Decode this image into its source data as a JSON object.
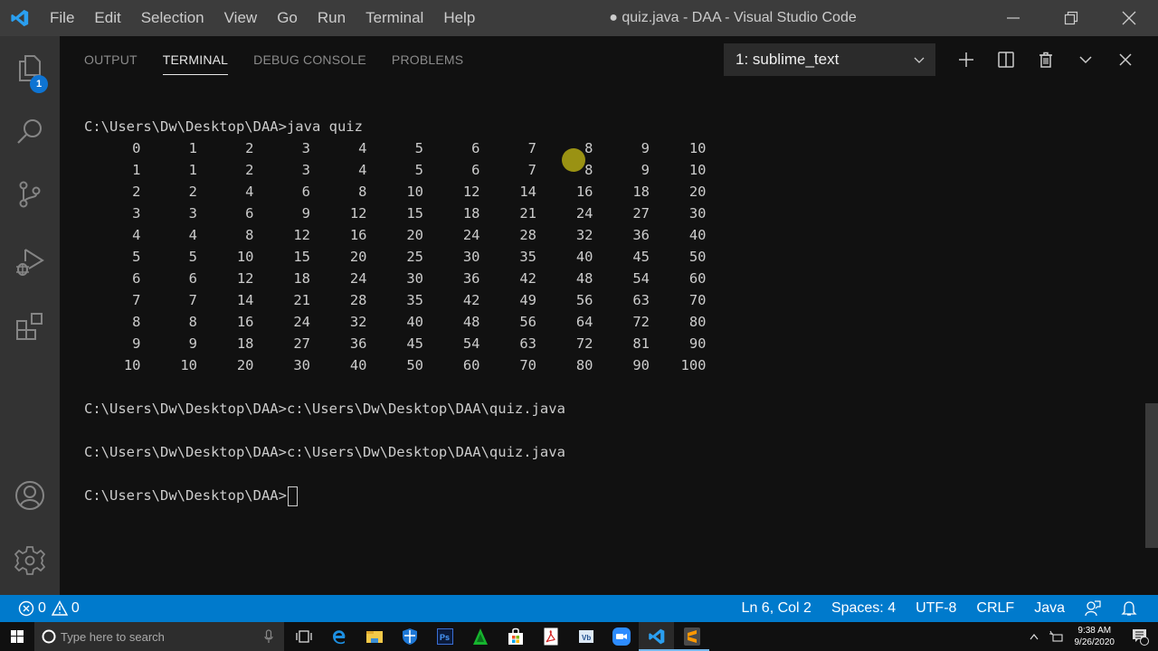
{
  "titlebar": {
    "menu": [
      "File",
      "Edit",
      "Selection",
      "View",
      "Go",
      "Run",
      "Terminal",
      "Help"
    ],
    "window_title": "● quiz.java - DAA - Visual Studio Code"
  },
  "activity_bar": {
    "items": [
      {
        "name": "explorer",
        "badge": "1"
      },
      {
        "name": "search"
      },
      {
        "name": "source-control"
      },
      {
        "name": "run-debug"
      },
      {
        "name": "extensions"
      }
    ],
    "bottom": [
      "accounts",
      "manage"
    ]
  },
  "panel": {
    "tabs": [
      {
        "label": "OUTPUT",
        "active": false
      },
      {
        "label": "TERMINAL",
        "active": true
      },
      {
        "label": "DEBUG CONSOLE",
        "active": false
      },
      {
        "label": "PROBLEMS",
        "active": false
      }
    ],
    "terminal_selector": "1: sublime_text",
    "actions": [
      "new-terminal",
      "split-terminal",
      "kill-terminal",
      "maximize-panel",
      "close-panel"
    ]
  },
  "terminal": {
    "command_line": "C:\\Users\\Dw\\Desktop\\DAA>java quiz",
    "table": [
      [
        "0",
        "1",
        "2",
        "3",
        "4",
        "5",
        "6",
        "7",
        "8",
        "9",
        "10"
      ],
      [
        "1",
        "1",
        "2",
        "3",
        "4",
        "5",
        "6",
        "7",
        "8",
        "9",
        "10"
      ],
      [
        "2",
        "2",
        "4",
        "6",
        "8",
        "10",
        "12",
        "14",
        "16",
        "18",
        "20"
      ],
      [
        "3",
        "3",
        "6",
        "9",
        "12",
        "15",
        "18",
        "21",
        "24",
        "27",
        "30"
      ],
      [
        "4",
        "4",
        "8",
        "12",
        "16",
        "20",
        "24",
        "28",
        "32",
        "36",
        "40"
      ],
      [
        "5",
        "5",
        "10",
        "15",
        "20",
        "25",
        "30",
        "35",
        "40",
        "45",
        "50"
      ],
      [
        "6",
        "6",
        "12",
        "18",
        "24",
        "30",
        "36",
        "42",
        "48",
        "54",
        "60"
      ],
      [
        "7",
        "7",
        "14",
        "21",
        "28",
        "35",
        "42",
        "49",
        "56",
        "63",
        "70"
      ],
      [
        "8",
        "8",
        "16",
        "24",
        "32",
        "40",
        "48",
        "56",
        "64",
        "72",
        "80"
      ],
      [
        "9",
        "9",
        "18",
        "27",
        "36",
        "45",
        "54",
        "63",
        "72",
        "81",
        "90"
      ],
      [
        "10",
        "10",
        "20",
        "30",
        "40",
        "50",
        "60",
        "70",
        "80",
        "90",
        "100"
      ]
    ],
    "after_lines": [
      "C:\\Users\\Dw\\Desktop\\DAA>c:\\Users\\Dw\\Desktop\\DAA\\quiz.java",
      "C:\\Users\\Dw\\Desktop\\DAA>c:\\Users\\Dw\\Desktop\\DAA\\quiz.java"
    ],
    "prompt": "C:\\Users\\Dw\\Desktop\\DAA>"
  },
  "statusbar": {
    "errors": "0",
    "warnings": "0",
    "position": "Ln 6, Col 2",
    "indent": "Spaces: 4",
    "encoding": "UTF-8",
    "eol": "CRLF",
    "language": "Java"
  },
  "taskbar": {
    "search_placeholder": "Type here to search",
    "time": "9:38 AM",
    "date": "9/26/2020",
    "notification_count": "1",
    "colors": {
      "statusbar": "#007acc",
      "accent": "#0e74d3"
    }
  }
}
